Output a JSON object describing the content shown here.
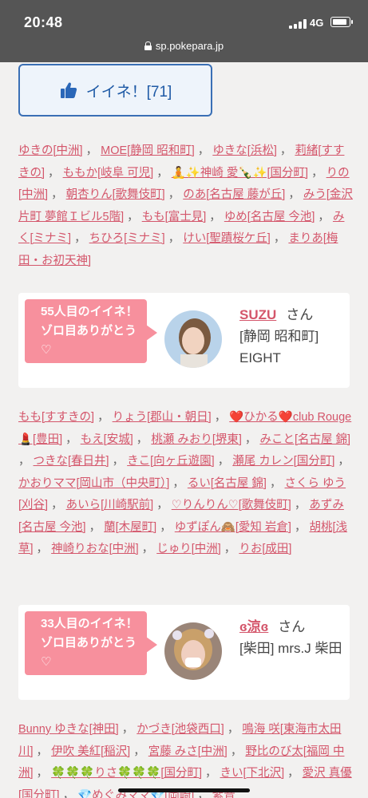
{
  "status": {
    "time": "20:48",
    "network": "4G",
    "url": "sp.pokepara.jp"
  },
  "like_button": {
    "label": "イイネ！[71]"
  },
  "list1": [
    "ゆきの[中洲]",
    "MOE[静岡 昭和町]",
    "ゆきな[浜松]",
    "莉緒[すすきの]",
    "ももか[岐阜 可児]",
    "🧘✨神崎 愛🍾✨[国分町]",
    "りの[中洲]",
    "朝杏りん[歌舞伎町]",
    "のあ[名古屋 藤が丘]",
    "みう[金沢片町 夢館Ｉビル5階]",
    "もも[富士見]",
    "ゆめ[名古屋 今池]",
    "みく[ミナミ]",
    "ちひろ[ミナミ]",
    "けい[聖蹟桜ケ丘]",
    "まりあ[梅田・お初天神]"
  ],
  "card1": {
    "bubble_text": "55人目のイイネ！ゾロ目ありがとう♡",
    "user_name": "SUZU",
    "honorific": "さん",
    "shop": "[静岡 昭和町] EIGHT"
  },
  "list2": [
    "もも[すすきの]",
    "りょう[郡山・朝日]",
    "❤️ひかる❤️club Rouge💄[豊田]",
    "もえ[安城]",
    "桃瀬 みおり[堺東]",
    "みこと[名古屋 錦]",
    "つきな[春日井]",
    "きこ[向ヶ丘遊園]",
    "瀬尾 カレン[国分町]",
    "かおりママ[岡山市（中央町）]",
    "るい[名古屋 錦]",
    "さくら ゆう[刈谷]",
    "あいら[川崎駅前]",
    "♡りんりん♡[歌舞伎町]",
    "あずみ[名古屋 今池]",
    "蘭[木屋町]",
    "ゆずぽん🙈[愛知 岩倉]",
    "胡桃[浅草]",
    "神崎りおな[中洲]",
    "じゅり[中洲]",
    "りお[成田]"
  ],
  "card2": {
    "bubble_text": "33人目のイイネ！ゾロ目ありがとう♡",
    "user_name": "ɞ涼ɞ",
    "honorific": "さん",
    "shop": "[柴田] mrs.J 柴田"
  },
  "list3": [
    "Bunny ゆきな[神田]",
    "かづき[池袋西口]",
    "鳴海 咲[東海市太田川]",
    "伊吹 美紅[稲沢]",
    "宮藤 みさ[中洲]",
    "野比のび太[福岡 中洲]",
    "🍀🍀🍀りさ🍀🍀🍀[国分町]",
    "きい[下北沢]",
    "愛沢 真優[国分町]",
    "💎めぐみママ💎[岡崎]",
    "紫音"
  ]
}
